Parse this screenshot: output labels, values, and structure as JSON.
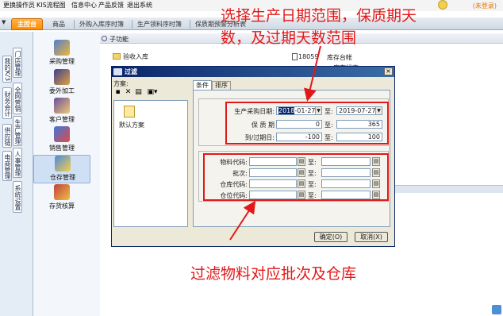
{
  "menubar": {
    "items": [
      "更换操作员",
      "KIS流程图",
      "信息中心",
      "产品反馈",
      "退出系统"
    ],
    "login_status": "(未登录)"
  },
  "tabbar": {
    "home": "主控台",
    "tabs": [
      "商品",
      "外购入库序时簿",
      "生产领料序时簿",
      "保质期预警分析表"
    ]
  },
  "sidebar": {
    "vertical_tabs": [
      "我的K/3",
      "门店管理",
      "财务会计",
      "全网营销",
      "供应链",
      "生产管理",
      "电商管理",
      "人事管理",
      "系统设置"
    ]
  },
  "modules": [
    "采购管理",
    "委外加工",
    "客户管理",
    "销售管理",
    "仓存管理",
    "存货核算"
  ],
  "subfunc": {
    "title": "子功能",
    "items": {
      "intake": "验收入库",
      "code": "18059",
      "inventory": "库存台帐",
      "stock": "库存状态"
    }
  },
  "dialog": {
    "title": "过滤",
    "close": "×",
    "scheme_label": "方案:",
    "scheme_item": "默认方案",
    "tabs": {
      "conditions": "条件",
      "sort": "排序"
    },
    "group1": {
      "date_label": "生产采购日期:",
      "date_from_selected": "2018",
      "date_from_rest": "-01-27",
      "to": "至:",
      "date_to": "2019-07-27",
      "shelf_label": "保 质 期",
      "shelf_from": "0",
      "shelf_to": "365",
      "expire_label": "到/过期日:",
      "expire_from": "-100",
      "expire_to": "100"
    },
    "group2": {
      "labels": [
        "物料代码:",
        "批次:",
        "仓库代码:",
        "仓位代码:"
      ],
      "to": "至:"
    },
    "ok_button": "确定(O)",
    "cancel_button": "取消(X)"
  },
  "annotations": {
    "top_line1": "选择生产日期范围，保质期天",
    "top_line2": "数，及过期天数范围",
    "bottom": "过滤物料对应批次及仓库"
  },
  "colors": {
    "annotation": "#e21818",
    "dialog_title_bg": "#0a246a",
    "home_tab": "#ff8c00"
  }
}
